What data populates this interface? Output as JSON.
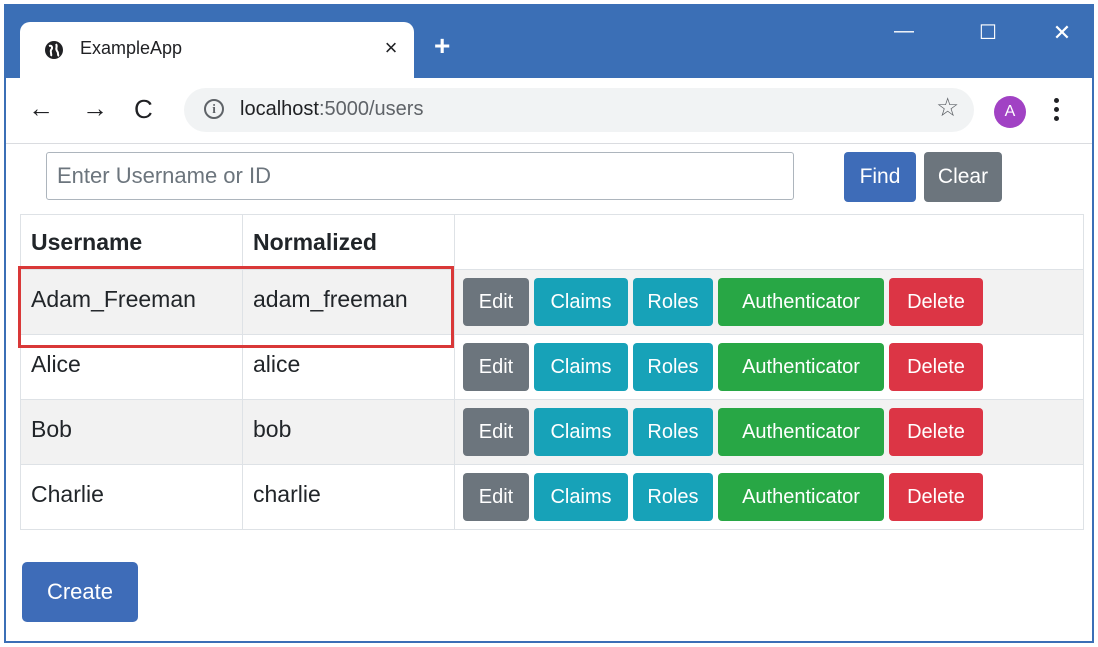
{
  "browser": {
    "tab_title": "ExampleApp",
    "tab_close": "×",
    "new_tab": "+",
    "url_host": "localhost",
    "url_path": ":5000/users",
    "avatar_letter": "A",
    "window_controls": {
      "minimize": "—",
      "maximize": "☐",
      "close": "✕"
    },
    "nav_icons": {
      "back": "←",
      "forward": "→",
      "reload": "C",
      "info": "i",
      "star": "☆"
    }
  },
  "search": {
    "placeholder": "Enter Username or ID",
    "value": "",
    "find_label": "Find",
    "clear_label": "Clear"
  },
  "table": {
    "headers": [
      "Username",
      "Normalized",
      ""
    ],
    "rows": [
      {
        "username": "Adam_Freeman",
        "normalized": "adam_freeman"
      },
      {
        "username": "Alice",
        "normalized": "alice"
      },
      {
        "username": "Bob",
        "normalized": "bob"
      },
      {
        "username": "Charlie",
        "normalized": "charlie"
      }
    ],
    "actions": {
      "edit": "Edit",
      "claims": "Claims",
      "roles": "Roles",
      "authenticator": "Authenticator",
      "delete": "Delete"
    }
  },
  "create_label": "Create",
  "colors": {
    "titlebar": "#3b6fb6",
    "primary": "#3e6cb8",
    "secondary": "#6c757d",
    "info": "#17a2b8",
    "success": "#28a745",
    "danger": "#dc3545",
    "highlight": "#d93838",
    "avatar": "#a142c4"
  }
}
